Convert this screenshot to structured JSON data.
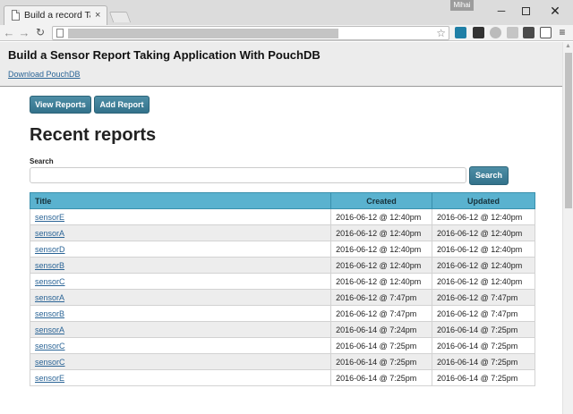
{
  "browser": {
    "tab_title": "Build a record Taking",
    "tab_close": "×",
    "user_badge": "Mihai",
    "window_minimize": "─",
    "window_close": "✕",
    "nav_back": "←",
    "nav_forward": "→",
    "nav_reload": "↻",
    "bookmark_star": "☆",
    "menu": "≡"
  },
  "header": {
    "title": "Build a Sensor Report Taking Application With PouchDB",
    "download_link": "Download PouchDB"
  },
  "actions": {
    "view_reports": "View Reports",
    "add_report": "Add Report"
  },
  "main": {
    "heading": "Recent reports",
    "search_label": "Search",
    "search_value": "",
    "search_button": "Search"
  },
  "table": {
    "columns": [
      "Title",
      "Created",
      "Updated"
    ],
    "rows": [
      {
        "title": "sensorE",
        "created": "2016-06-12 @ 12:40pm",
        "updated": "2016-06-12 @ 12:40pm"
      },
      {
        "title": "sensorA",
        "created": "2016-06-12 @ 12:40pm",
        "updated": "2016-06-12 @ 12:40pm"
      },
      {
        "title": "sensorD",
        "created": "2016-06-12 @ 12:40pm",
        "updated": "2016-06-12 @ 12:40pm"
      },
      {
        "title": "sensorB",
        "created": "2016-06-12 @ 12:40pm",
        "updated": "2016-06-12 @ 12:40pm"
      },
      {
        "title": "sensorC",
        "created": "2016-06-12 @ 12:40pm",
        "updated": "2016-06-12 @ 12:40pm"
      },
      {
        "title": "sensorA",
        "created": "2016-06-12 @ 7:47pm",
        "updated": "2016-06-12 @ 7:47pm"
      },
      {
        "title": "sensorB",
        "created": "2016-06-12 @ 7:47pm",
        "updated": "2016-06-12 @ 7:47pm"
      },
      {
        "title": "sensorA",
        "created": "2016-06-14 @ 7:24pm",
        "updated": "2016-06-14 @ 7:25pm"
      },
      {
        "title": "sensorC",
        "created": "2016-06-14 @ 7:25pm",
        "updated": "2016-06-14 @ 7:25pm"
      },
      {
        "title": "sensorC",
        "created": "2016-06-14 @ 7:25pm",
        "updated": "2016-06-14 @ 7:25pm"
      },
      {
        "title": "sensorE",
        "created": "2016-06-14 @ 7:25pm",
        "updated": "2016-06-14 @ 7:25pm"
      }
    ]
  },
  "colors": {
    "button": "#3b7d95",
    "table_header": "#5ab2cf",
    "link": "#2a6496"
  }
}
